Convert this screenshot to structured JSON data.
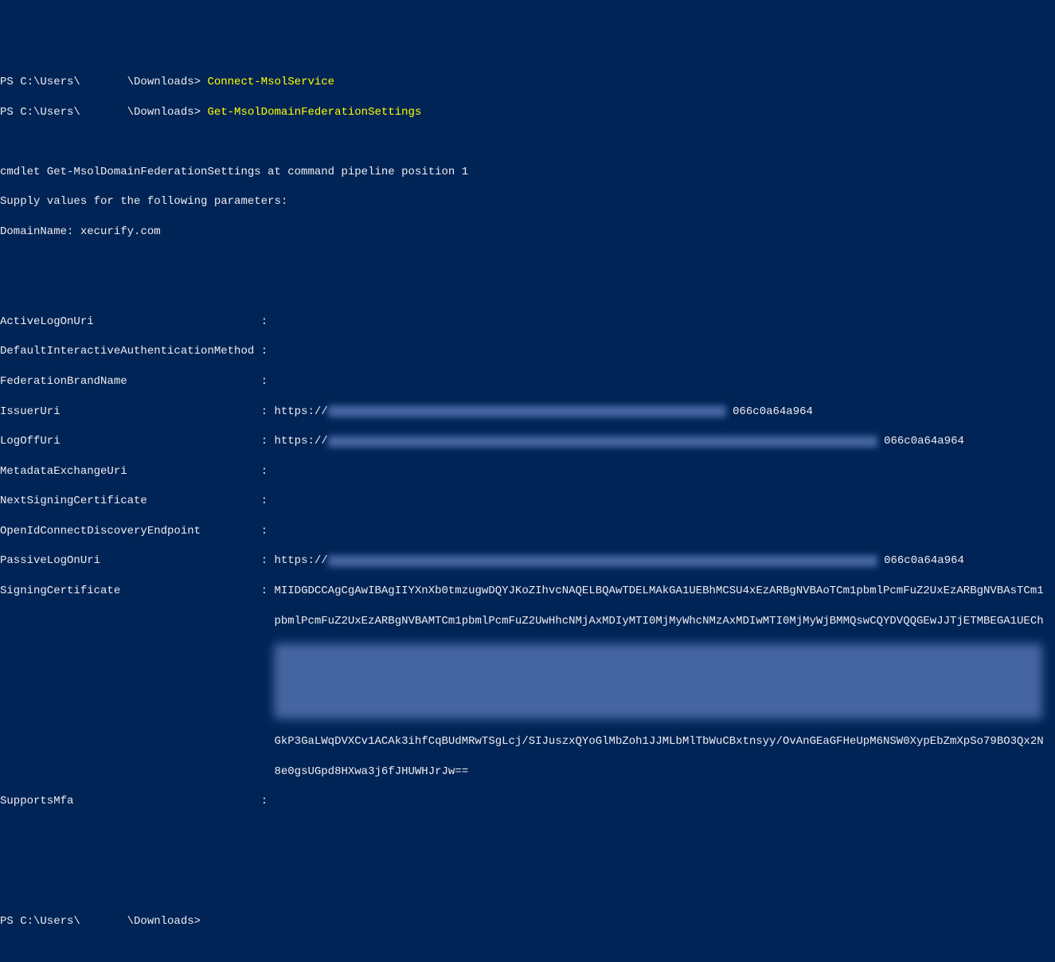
{
  "prompt_path": "PS C:\\Users\\       \\Downloads> ",
  "commands": {
    "cmd1": "Connect-MsolService",
    "cmd2": "Get-MsolDomainFederationSettings"
  },
  "cmdlet_info": {
    "line1": "cmdlet Get-MsolDomainFederationSettings at command pipeline position 1",
    "line2": "Supply values for the following parameters:",
    "line3_key": "DomainName: ",
    "line3_val": "xecurify.com"
  },
  "settings": {
    "activeLogOnUri_key": "ActiveLogOnUri",
    "activeLogOnUri_val": "",
    "defaultInteractiveAuthenticationMethod_key": "DefaultInteractiveAuthenticationMethod",
    "defaultInteractiveAuthenticationMethod_val": "",
    "federationBrandName_key": "FederationBrandName",
    "federationBrandName_val": "",
    "issuerUri_key": "IssuerUri",
    "issuerUri_prefix": "https://",
    "issuerUri_suffix": "066c0a64a964",
    "logOffUri_key": "LogOffUri",
    "logOffUri_prefix": "https://",
    "logOffUri_suffix": "066c0a64a964",
    "metadataExchangeUri_key": "MetadataExchangeUri",
    "metadataExchangeUri_val": "",
    "nextSigningCertificate_key": "NextSigningCertificate",
    "nextSigningCertificate_val": "",
    "openIdConnectDiscoveryEndpoint_key": "OpenIdConnectDiscoveryEndpoint",
    "openIdConnectDiscoveryEndpoint_val": "",
    "passiveLogOnUri_key": "PassiveLogOnUri",
    "passiveLogOnUri_prefix": "https://",
    "passiveLogOnUri_suffix": "066c0a64a964",
    "signingCertificate_key": "SigningCertificate",
    "signingCertificate_line1": "MIIDGDCCAgCgAwIBAgIIYXnXb0tmzugwDQYJKoZIhvcNAQELBQAwTDELMAkGA1UEBhMCSU4xEzARBgNVBAoTCm1pbmlPcmFuZ2UxEzARBgNVBAsTCm1",
    "signingCertificate_line2": "pbmlPcmFuZ2UxEzARBgNVBAMTCm1pbmlPcmFuZ2UwHhcNMjAxMDIyMTI0MjMyWhcNMzAxMDIwMTI0MjMyWjBMMQswCQYDVQQGEwJJTjETMBEGA1UECh",
    "signingCertificate_line7": "GkP3GaLWqDVXCv1ACAk3ihfCqBUdMRwTSgLcj/SIJuszxQYoGlMbZoh1JJMLbMlTbWuCBxtnsyy/OvAnGEaGFHeUpM6NSW0XypEbZmXpSo79BO3Qx2N",
    "signingCertificate_line8": "8e0gsUGpd8HXwa3j6fJHUWHJrJw==",
    "supportsMfa_key": "SupportsMfa",
    "supportsMfa_val": ""
  },
  "colon": " : ",
  "pad": "                                       ",
  "final_prompt": "PS C:\\Users\\       \\Downloads> "
}
